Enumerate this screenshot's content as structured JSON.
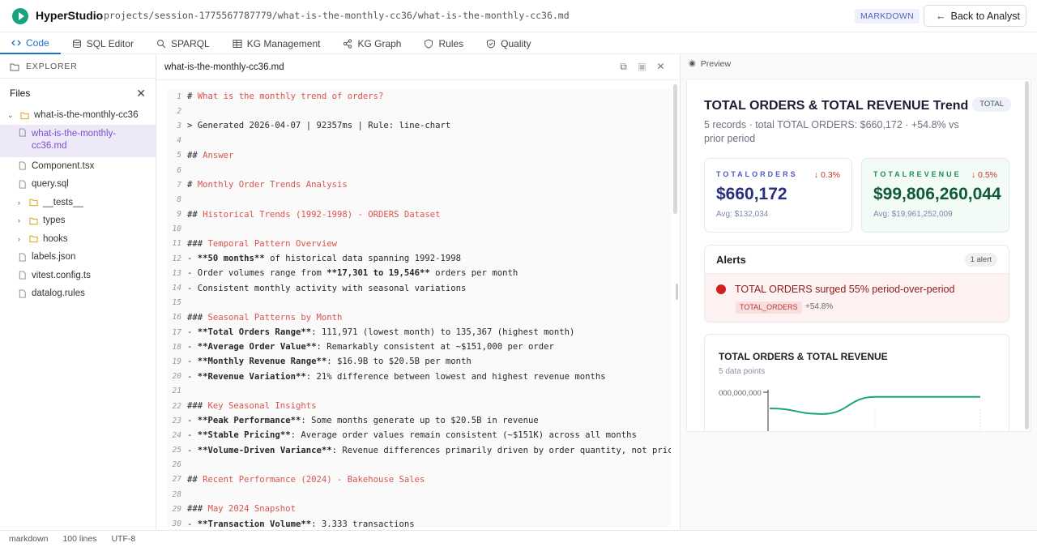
{
  "app": {
    "title": "HyperStudio",
    "path": "projects/session-1775567787779/what-is-the-monthly-cc36/what-is-the-monthly-cc36.md",
    "badge": "MARKDOWN",
    "back_label": "Back to Analyst"
  },
  "tabs": [
    {
      "label": "Code",
      "icon": "code-icon",
      "active": true
    },
    {
      "label": "SQL Editor",
      "icon": "database-icon"
    },
    {
      "label": "SPARQL",
      "icon": "search-icon"
    },
    {
      "label": "KG Management",
      "icon": "table-icon"
    },
    {
      "label": "KG Graph",
      "icon": "share-icon"
    },
    {
      "label": "Rules",
      "icon": "shield-icon"
    },
    {
      "label": "Quality",
      "icon": "check-shield-icon"
    }
  ],
  "sidebar": {
    "explorer_label": "EXPLORER",
    "files_label": "Files",
    "tree": [
      {
        "label": "what-is-the-monthly-cc36",
        "type": "folder-open"
      },
      {
        "label": "what-is-the-monthly-cc36.md",
        "type": "file",
        "selected": true
      },
      {
        "label": "Component.tsx",
        "type": "file"
      },
      {
        "label": "query.sql",
        "type": "file"
      },
      {
        "label": "__tests__",
        "type": "folder"
      },
      {
        "label": "types",
        "type": "folder"
      },
      {
        "label": "hooks",
        "type": "folder"
      },
      {
        "label": "labels.json",
        "type": "file"
      },
      {
        "label": "vitest.config.ts",
        "type": "file"
      },
      {
        "label": "datalog.rules",
        "type": "file"
      }
    ]
  },
  "editor": {
    "filename": "what-is-the-monthly-cc36.md",
    "lines": [
      {
        "n": "1",
        "segs": [
          [
            "p",
            "# "
          ],
          [
            "h",
            "What is the monthly trend of orders?"
          ]
        ]
      },
      {
        "n": "2",
        "segs": []
      },
      {
        "n": "3",
        "segs": [
          [
            "p",
            "> Generated 2026-04-07 | 92357ms | Rule: line-chart"
          ]
        ]
      },
      {
        "n": "4",
        "segs": []
      },
      {
        "n": "5",
        "segs": [
          [
            "p",
            "## "
          ],
          [
            "h",
            "Answer"
          ]
        ]
      },
      {
        "n": "6",
        "segs": []
      },
      {
        "n": "7",
        "segs": [
          [
            "p",
            "# "
          ],
          [
            "h",
            "Monthly Order Trends Analysis"
          ]
        ]
      },
      {
        "n": "8",
        "segs": []
      },
      {
        "n": "9",
        "segs": [
          [
            "p",
            "## "
          ],
          [
            "h",
            "Historical Trends (1992-1998) - ORDERS Dataset"
          ]
        ]
      },
      {
        "n": "10",
        "segs": []
      },
      {
        "n": "11",
        "segs": [
          [
            "p",
            "### "
          ],
          [
            "h",
            "Temporal Pattern Overview"
          ]
        ]
      },
      {
        "n": "12",
        "segs": [
          [
            "p",
            "- "
          ],
          [
            "b",
            "**50 months**"
          ],
          [
            "p",
            " of historical data spanning 1992-1998"
          ]
        ]
      },
      {
        "n": "13",
        "segs": [
          [
            "p",
            "- Order volumes range from "
          ],
          [
            "b",
            "**17,301 to 19,546**"
          ],
          [
            "p",
            " orders per month"
          ]
        ]
      },
      {
        "n": "14",
        "segs": [
          [
            "p",
            "- Consistent monthly activity with seasonal variations"
          ]
        ]
      },
      {
        "n": "15",
        "segs": []
      },
      {
        "n": "16",
        "segs": [
          [
            "p",
            "### "
          ],
          [
            "h",
            "Seasonal Patterns by Month"
          ]
        ]
      },
      {
        "n": "17",
        "segs": [
          [
            "p",
            "- "
          ],
          [
            "b",
            "**Total Orders Range**"
          ],
          [
            "p",
            ": 111,971 (lowest month) to 135,367 (highest month)"
          ]
        ]
      },
      {
        "n": "18",
        "segs": [
          [
            "p",
            "- "
          ],
          [
            "b",
            "**Average Order Value**"
          ],
          [
            "p",
            ": Remarkably consistent at ~$151,000 per order"
          ]
        ]
      },
      {
        "n": "19",
        "segs": [
          [
            "p",
            "- "
          ],
          [
            "b",
            "**Monthly Revenue Range**"
          ],
          [
            "p",
            ": $16.9B to $20.5B per month"
          ]
        ]
      },
      {
        "n": "20",
        "segs": [
          [
            "p",
            "- "
          ],
          [
            "b",
            "**Revenue Variation**"
          ],
          [
            "p",
            ": 21% difference between lowest and highest revenue months"
          ]
        ]
      },
      {
        "n": "21",
        "segs": []
      },
      {
        "n": "22",
        "segs": [
          [
            "p",
            "### "
          ],
          [
            "h",
            "Key Seasonal Insights"
          ]
        ]
      },
      {
        "n": "23",
        "segs": [
          [
            "p",
            "- "
          ],
          [
            "b",
            "**Peak Performance**"
          ],
          [
            "p",
            ": Some months generate up to $20.5B in revenue"
          ]
        ]
      },
      {
        "n": "24",
        "segs": [
          [
            "p",
            "- "
          ],
          [
            "b",
            "**Stable Pricing**"
          ],
          [
            "p",
            ": Average order values remain consistent (~$151K) across all months"
          ]
        ]
      },
      {
        "n": "25",
        "segs": [
          [
            "p",
            "- "
          ],
          [
            "b",
            "**Volume-Driven Variance**"
          ],
          [
            "p",
            ": Revenue differences primarily driven by order quantity, not pricing"
          ]
        ]
      },
      {
        "n": "26",
        "segs": []
      },
      {
        "n": "27",
        "segs": [
          [
            "p",
            "## "
          ],
          [
            "h",
            "Recent Performance (2024) - Bakehouse Sales"
          ]
        ]
      },
      {
        "n": "28",
        "segs": []
      },
      {
        "n": "29",
        "segs": [
          [
            "p",
            "### "
          ],
          [
            "h",
            "May 2024 Snapshot"
          ]
        ]
      },
      {
        "n": "30",
        "segs": [
          [
            "p",
            "- "
          ],
          [
            "b",
            "**Transaction Volume**"
          ],
          [
            "p",
            ": 3,333 transactions"
          ]
        ]
      }
    ]
  },
  "preview": {
    "label": "Preview",
    "title": "TOTAL ORDERS & TOTAL REVENUE Trend",
    "pill": "TOTAL",
    "subtitle": "5 records · total TOTAL ORDERS: $660,172 · +54.8% vs prior period",
    "kpi1": {
      "label": "TOTALORDERS",
      "delta": "↓ 0.3%",
      "value": "$660,172",
      "avg": "Avg: $132,034"
    },
    "kpi2": {
      "label": "TOTALREVENUE",
      "delta": "↓ 0.5%",
      "value": "$99,806,260,044",
      "avg": "Avg: $19,961,252,009"
    },
    "alerts": {
      "title": "Alerts",
      "count": "1 alert",
      "text": "TOTAL ORDERS surged 55% period-over-period",
      "tag": "TOTAL_ORDERS",
      "pct": "+54.8%"
    },
    "chart": {
      "title": "TOTAL ORDERS & TOTAL REVENUE",
      "sub": "5 data points",
      "ytick": "000,000,000"
    }
  },
  "chart_data": {
    "type": "line",
    "title": "TOTAL ORDERS & TOTAL REVENUE",
    "y_tick_labels": [
      "000,000,000"
    ],
    "series": [
      {
        "values": [
          0.72,
          0.62,
          0.93,
          0.93,
          0.93
        ]
      }
    ],
    "color": "#18a67a"
  },
  "statusbar": {
    "lang": "markdown",
    "lines": "100 lines",
    "encoding": "UTF-8"
  },
  "colors": {
    "accent": "#1a73c7",
    "brand": "#16a37f",
    "heading": "#d9534f"
  }
}
